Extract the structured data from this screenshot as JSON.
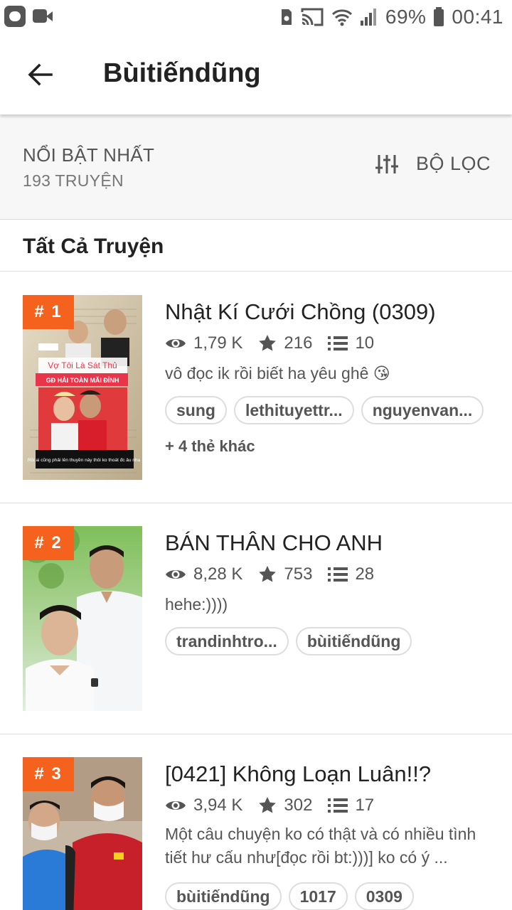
{
  "status_bar": {
    "battery": "69%",
    "time": "00:41"
  },
  "toolbar": {
    "title": "Bùitiếndũng"
  },
  "filter": {
    "sort_label": "NỔI BẬT NHẤT",
    "count_label": "193 TRUYỆN",
    "filter_label": "BỘ LỌC"
  },
  "section": {
    "title": "Tất Cả Truyện"
  },
  "stories": [
    {
      "rank": "# 1",
      "title": "Nhật Kí Cưới Chồng (0309)",
      "views": "1,79 K",
      "votes": "216",
      "parts": "10",
      "description": "vô đọc ik rồi biết ha yêu ghê 😘",
      "tags": [
        "sung",
        "lethituyettr...",
        "nguyenvan..."
      ],
      "more_tags": "+ 4 thẻ khác",
      "cover_text": [
        "Vợ Tôi Là Sát Thủ",
        "GĐ HẢI TOÀN MÃI ĐỈNH",
        "Rồi ai cũng phải lên thuyền này thôi ko thoát đc âu nha"
      ]
    },
    {
      "rank": "# 2",
      "title": "BÁN THÂN CHO ANH",
      "views": "8,28 K",
      "votes": "753",
      "parts": "28",
      "description": "hehe:))))",
      "tags": [
        "trandinhtro...",
        "bùitiếndũng"
      ]
    },
    {
      "rank": "# 3",
      "title": "[0421] Không Loạn Luân!!?",
      "views": "3,94 K",
      "votes": "302",
      "parts": "17",
      "description": "Một câu chuyện ko có thật và có nhiều tình tiết hư cấu như[đọc rồi bt:)))] ko có ý ...",
      "tags": [
        "bùitiếndũng",
        "1017",
        "0309"
      ]
    }
  ],
  "colors": {
    "accent": "#f5621e",
    "text": "#222222",
    "muted": "#555555",
    "divider": "#dddddd"
  }
}
